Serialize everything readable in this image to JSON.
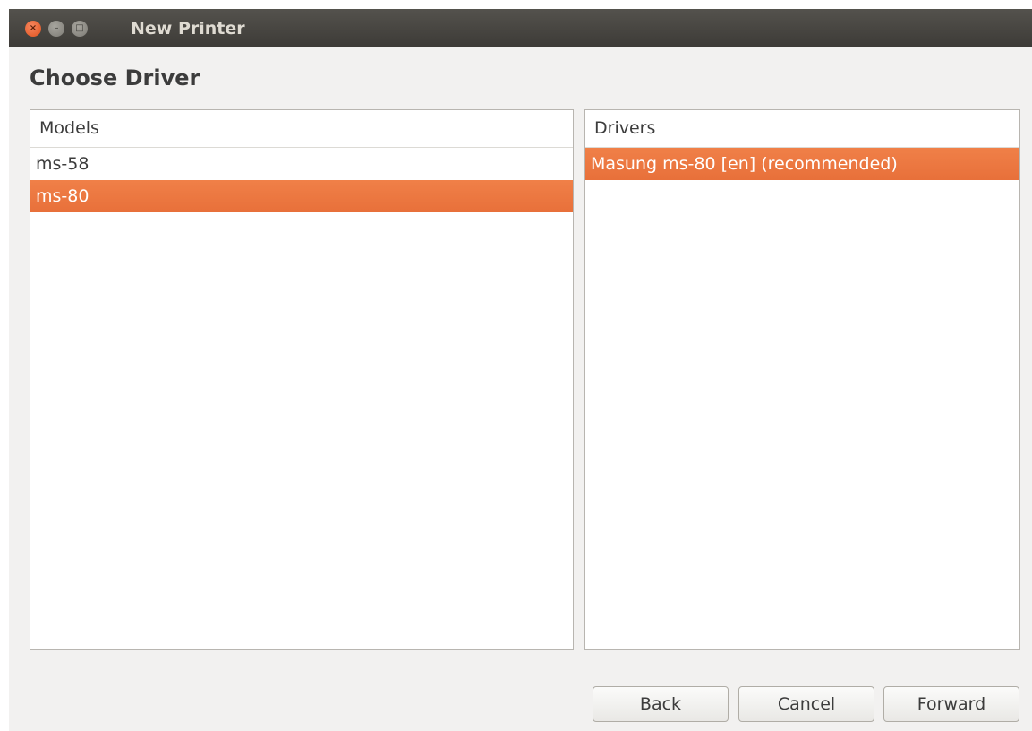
{
  "window": {
    "title": "New Printer",
    "controls": {
      "close_glyph": "×",
      "minimize_glyph": "–",
      "maximize_glyph": "□"
    }
  },
  "page": {
    "heading": "Choose Driver"
  },
  "models": {
    "header": "Models",
    "items": [
      "ms-58",
      "ms-80"
    ],
    "selected": "ms-80"
  },
  "drivers": {
    "header": "Drivers",
    "items": [
      "Masung ms-80 [en] (recommended)"
    ],
    "selected": "Masung ms-80 [en] (recommended)"
  },
  "buttons": {
    "back": "Back",
    "cancel": "Cancel",
    "forward": "Forward"
  },
  "colors": {
    "selection": "#f07746",
    "titlebar": "#3c3b37",
    "close_button": "#e95420"
  }
}
